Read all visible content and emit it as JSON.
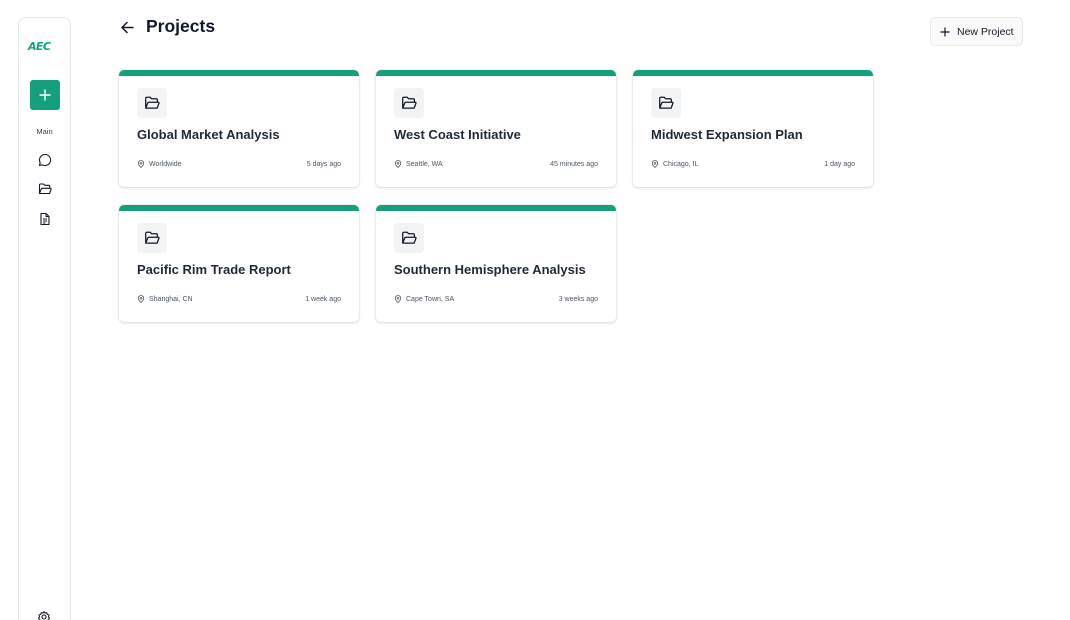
{
  "sidebar": {
    "logo_text": "AEC",
    "section_label": "Main",
    "nav": [
      {
        "name": "chat-icon"
      },
      {
        "name": "folder-open-icon"
      },
      {
        "name": "document-icon"
      }
    ],
    "accent_color": "#14a07c"
  },
  "header": {
    "title": "Projects",
    "new_project_label": "New Project"
  },
  "projects": [
    {
      "title": "Global Market Analysis",
      "location": "Worldwide",
      "updated": "5 days ago"
    },
    {
      "title": "West Coast Initiative",
      "location": "Seattle, WA",
      "updated": "45 minutes ago"
    },
    {
      "title": "Midwest Expansion Plan",
      "location": "Chicago, IL",
      "updated": "1 day ago"
    },
    {
      "title": "Pacific Rim Trade Report",
      "location": "Shanghai, CN",
      "updated": "1 week ago"
    },
    {
      "title": "Southern Hemisphere Analysis",
      "location": "Cape Town, SA",
      "updated": "3 weeks ago"
    }
  ]
}
